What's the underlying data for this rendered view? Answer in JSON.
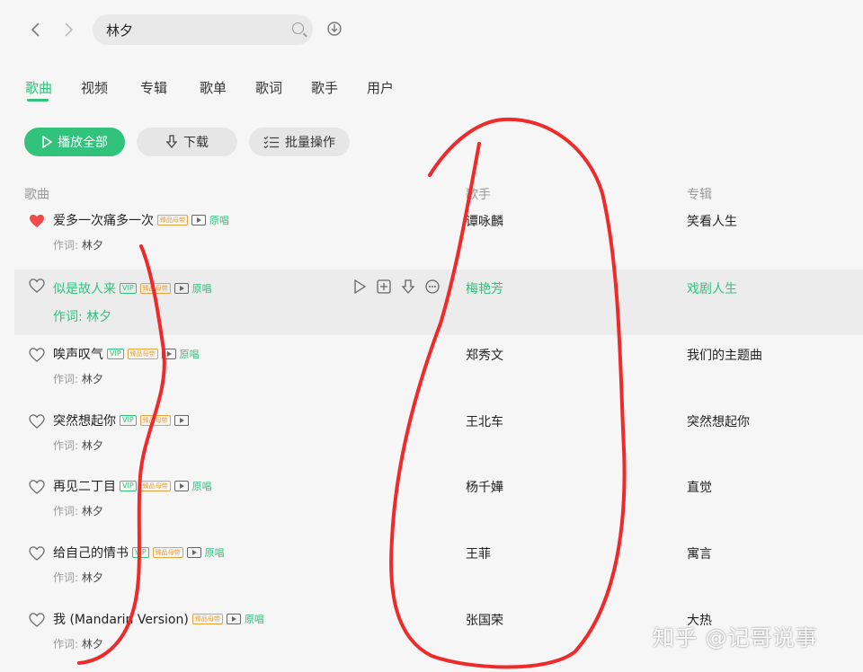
{
  "search": {
    "value": "林夕"
  },
  "tabs": [
    {
      "label": "歌曲",
      "active": true
    },
    {
      "label": "视频"
    },
    {
      "label": "专辑"
    },
    {
      "label": "歌单"
    },
    {
      "label": "歌词"
    },
    {
      "label": "歌手"
    },
    {
      "label": "用户"
    }
  ],
  "actions": {
    "play_all": "播放全部",
    "download": "下载",
    "batch": "批量操作"
  },
  "columns": {
    "song": "歌曲",
    "artist": "歌手",
    "album": "专辑"
  },
  "lyricist_prefix": "作词:",
  "badges": {
    "vip": "VIP",
    "hq": "臻品母带",
    "original": "原唱"
  },
  "songs": [
    {
      "title": "爱多一次痛多一次",
      "lyricist": "林夕",
      "artist": "谭咏麟",
      "album": "笑看人生",
      "liked": true
    },
    {
      "title": "似是故人来",
      "lyricist": "林夕",
      "artist": "梅艳芳",
      "album": "戏剧人生",
      "liked": false
    },
    {
      "title": "唉声叹气",
      "lyricist": "林夕",
      "artist": "郑秀文",
      "album": "我们的主题曲",
      "liked": false
    },
    {
      "title": "突然想起你",
      "lyricist": "林夕",
      "artist": "王北车",
      "album": "突然想起你",
      "liked": false
    },
    {
      "title": "再见二丁目",
      "lyricist": "林夕",
      "artist": "杨千嬅",
      "album": "直觉",
      "liked": false
    },
    {
      "title": "给自己的情书",
      "lyricist": "林夕",
      "artist": "王菲",
      "album": "寓言",
      "liked": false
    },
    {
      "title": "我 (Mandarin Version)",
      "lyricist": "林夕",
      "artist": "张国荣",
      "album": "大热",
      "liked": false
    }
  ],
  "watermark": "知乎 @记哥说事",
  "colors": {
    "accent": "#31c27c",
    "heart": "#f04a4a",
    "annotation": "#ee2a2a"
  }
}
